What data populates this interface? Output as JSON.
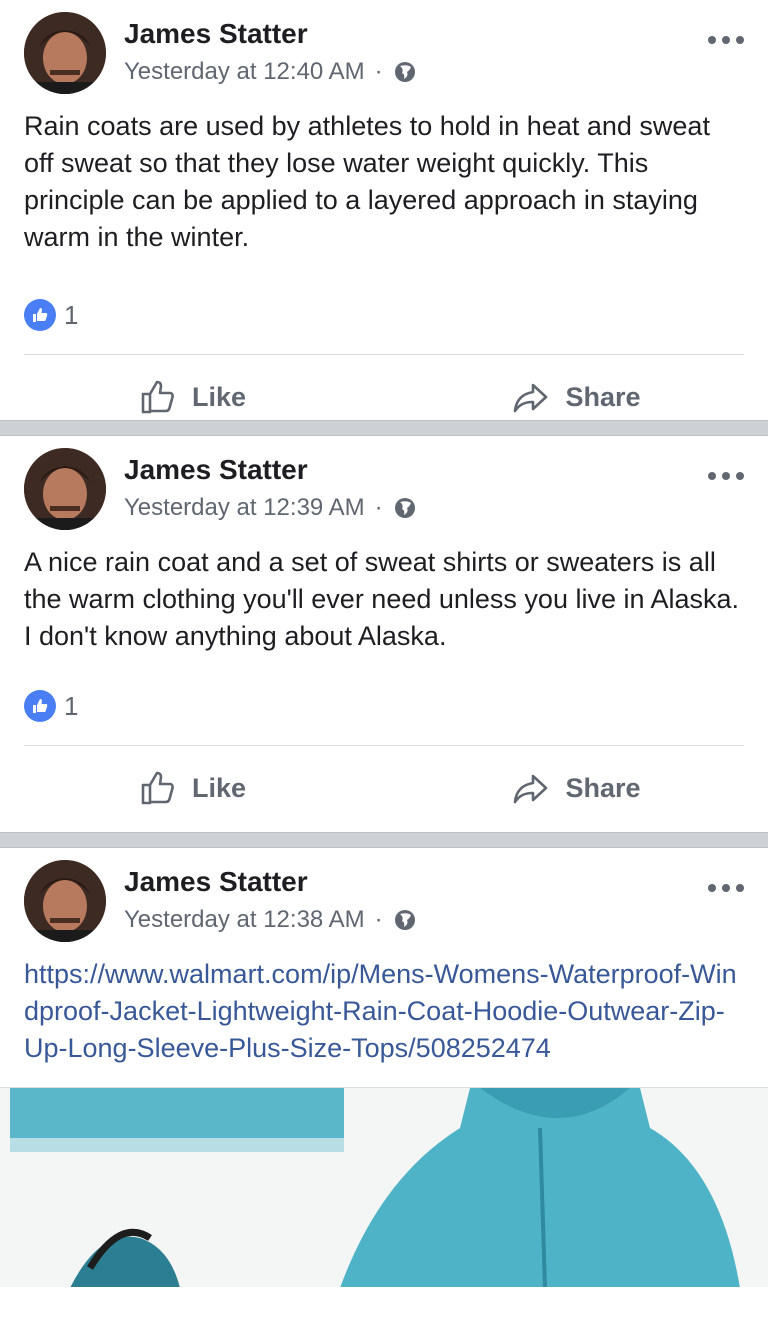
{
  "posts": [
    {
      "author": "James Statter",
      "time": "Yesterday at 12:40 AM",
      "dot": "·",
      "text": "Rain coats are used by athletes to hold in heat and sweat off sweat so that they lose water weight quickly. This principle can be applied to a layered approach in staying warm in the winter.",
      "likes": "1"
    },
    {
      "author": "James Statter",
      "time": "Yesterday at 12:39 AM",
      "dot": "·",
      "text": "A nice rain coat and a set of sweat shirts or sweaters is all the warm clothing you'll ever need unless you live in Alaska. I don't know anything about Alaska.",
      "likes": "1"
    },
    {
      "author": "James Statter",
      "time": "Yesterday at 12:38 AM",
      "dot": "·",
      "link": "https://www.walmart.com/ip/Mens-Womens-Waterproof-Windproof-Jacket-Lightweight-Rain-Coat-Hoodie-Outwear-Zip-Up-Long-Sleeve-Plus-Size-Tops/508252474"
    }
  ],
  "actions": {
    "like_label": "Like",
    "share_label": "Share"
  },
  "colors": {
    "like_blue": "#4a7ef5",
    "link_blue": "#385898",
    "divider": "#cdd0d4",
    "coat": "#4fb3c8"
  },
  "icons": [
    "globe-icon",
    "more-options-icon",
    "like-reaction-icon",
    "thumbs-up-icon",
    "share-arrow-icon"
  ]
}
